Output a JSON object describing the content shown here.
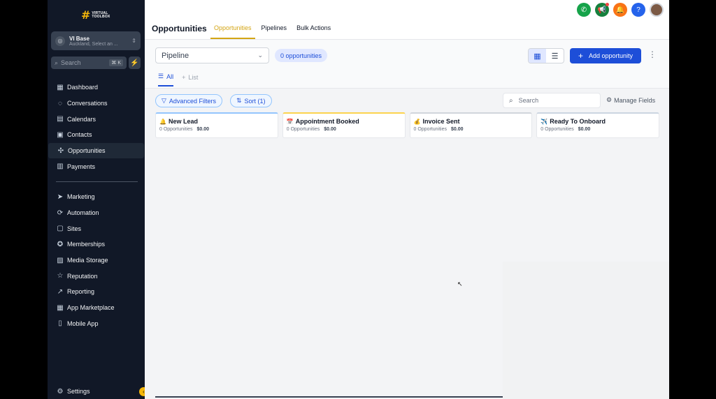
{
  "brand": {
    "mark": "#",
    "text": "VIRTUAL TOOLBOX"
  },
  "location": {
    "name": "VI Base",
    "sub": "Auckland, Select an ..."
  },
  "sidebar_search": {
    "placeholder": "Search",
    "shortcut": "⌘ K"
  },
  "nav_primary": [
    {
      "label": "Dashboard",
      "icon": "dashboard-icon"
    },
    {
      "label": "Conversations",
      "icon": "chat-icon"
    },
    {
      "label": "Calendars",
      "icon": "calendar-icon"
    },
    {
      "label": "Contacts",
      "icon": "contacts-icon"
    },
    {
      "label": "Opportunities",
      "icon": "opportunities-icon",
      "active": true
    },
    {
      "label": "Payments",
      "icon": "payments-icon"
    }
  ],
  "nav_secondary": [
    {
      "label": "Marketing",
      "icon": "send-icon"
    },
    {
      "label": "Automation",
      "icon": "automation-icon"
    },
    {
      "label": "Sites",
      "icon": "sites-icon"
    },
    {
      "label": "Memberships",
      "icon": "membership-icon"
    },
    {
      "label": "Media Storage",
      "icon": "image-icon"
    },
    {
      "label": "Reputation",
      "icon": "star-icon"
    },
    {
      "label": "Reporting",
      "icon": "trend-icon"
    },
    {
      "label": "App Marketplace",
      "icon": "grid-icon"
    },
    {
      "label": "Mobile App",
      "icon": "phone-icon"
    }
  ],
  "settings_label": "Settings",
  "header": {
    "title": "Opportunities",
    "tabs": [
      {
        "label": "Opportunities",
        "active": true
      },
      {
        "label": "Pipelines"
      },
      {
        "label": "Bulk Actions"
      }
    ],
    "icon_colors": {
      "phone": "#16a34a",
      "megaphone": "#15803d",
      "bell": "#f97316",
      "help": "#2563eb"
    }
  },
  "toolbar": {
    "pipeline_value": "Pipeline",
    "count": "0 opportunities",
    "add_label": "Add opportunity",
    "view_tabs": [
      {
        "label": "All",
        "active": true
      },
      {
        "label": "List"
      }
    ]
  },
  "filters": {
    "advanced": "Advanced Filters",
    "sort": "Sort (1)",
    "search_placeholder": "Search",
    "manage": "Manage Fields"
  },
  "stages": [
    {
      "emoji": "🔔",
      "name": "New Lead",
      "count": "0 Opportunities",
      "amount": "$0.00",
      "color": "#93c5fd"
    },
    {
      "emoji": "📅",
      "name": "Appointment Booked",
      "count": "0 Opportunities",
      "amount": "$0.00",
      "color": "#fcd34d"
    },
    {
      "emoji": "💰",
      "name": "Invoice Sent",
      "count": "0 Opportunities",
      "amount": "$0.00",
      "color": "#d1d5db"
    },
    {
      "emoji": "✈️",
      "name": "Ready To Onboard",
      "count": "0 Opportunities",
      "amount": "$0.00",
      "color": "#cbd5e1"
    }
  ],
  "colors": {
    "accent": "#1d4ed8",
    "tab_active": "#d4a514",
    "sidebar_bg": "#111827"
  }
}
